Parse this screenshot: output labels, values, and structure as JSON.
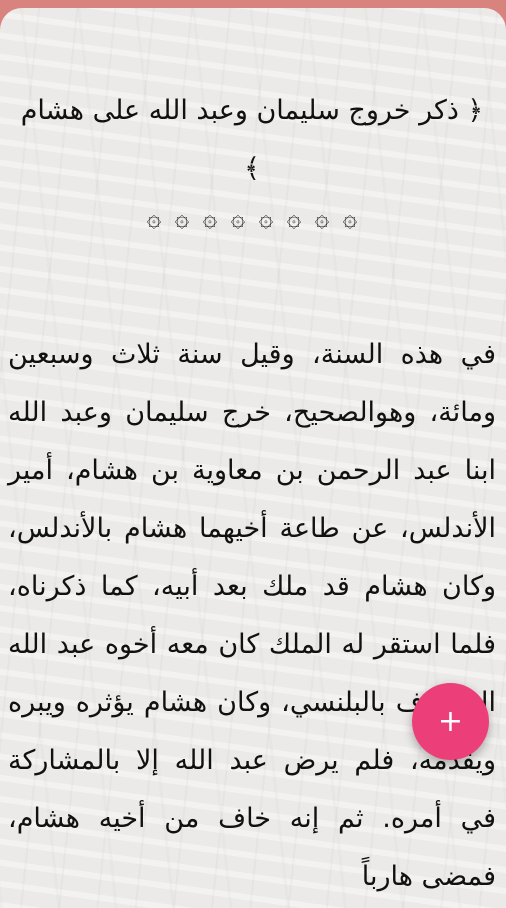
{
  "chapter": {
    "title": "﴿ ذكر خروج سليمان وعبد الله على هشام ﴾",
    "ornament": "۞۞۞۞۞۞۞۞"
  },
  "body": {
    "text": "في هذه السنة، وقيل سنة ثلاث وسبعين ومائة، وهوالصحيح، خرج سليمان وعبد الله ابنا عبد الرحمن بن معاوية بن هشام، أمير الأندلس، عن طاعة أخيهما هشام بالأندلس، وكان هشام قد ملك بعد أبيه، كما ذكرناه، فلما استقر له الملك كان معه أخوه عبد الله المعروف بالبلنسي، وكان هشام يؤثره ويبره ويقدمه، فلم يرض عبد الله إلا بالمشاركة في أمره. ثم إنه خاف من أخيه هشام، فمضى هارباً"
  },
  "fab": {
    "icon": "plus-icon",
    "label": "+"
  },
  "colors": {
    "accent": "#ec3f7a",
    "topbar": "#d9837f",
    "paper": "#ecebe8"
  }
}
